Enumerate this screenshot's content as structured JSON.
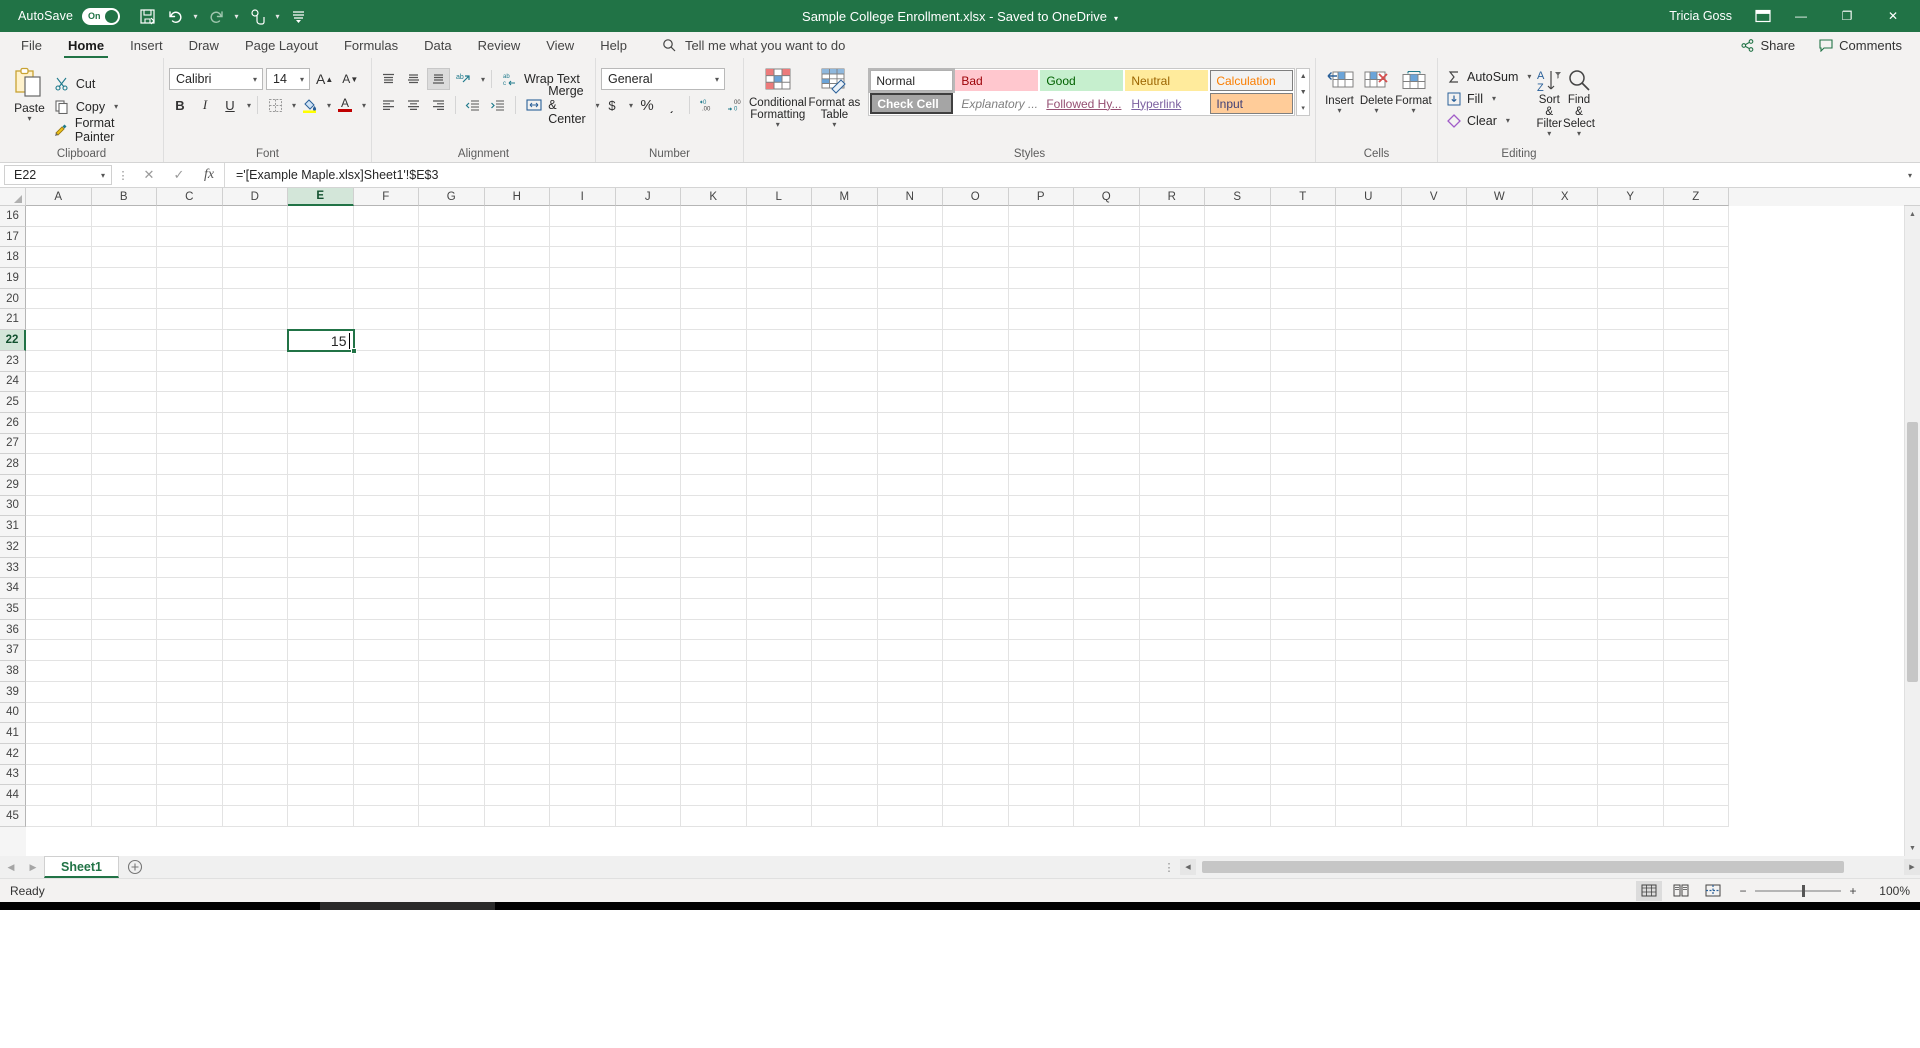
{
  "titlebar": {
    "autosave_label": "AutoSave",
    "autosave_state": "On",
    "document_title": "Sample College Enrollment.xlsx  -  Saved to OneDrive",
    "user_name": "Tricia Goss",
    "qat": [
      {
        "name": "save-icon",
        "glyph": "ὋE"
      },
      {
        "name": "undo-icon",
        "glyph": "↶"
      },
      {
        "name": "redo-icon",
        "glyph": "↷"
      },
      {
        "name": "touch-mode-icon",
        "glyph": "☝"
      },
      {
        "name": "customize-qat-icon",
        "glyph": "≡"
      }
    ],
    "window_buttons": {
      "minimize": "—",
      "restore": "❐",
      "close": "✕"
    },
    "ribbon_display_icon": "ribbon-display-options-icon",
    "accent_color": "#217346"
  },
  "ribbon": {
    "tabs": [
      {
        "label": "File",
        "active": false
      },
      {
        "label": "Home",
        "active": true
      },
      {
        "label": "Insert",
        "active": false
      },
      {
        "label": "Draw",
        "active": false
      },
      {
        "label": "Page Layout",
        "active": false
      },
      {
        "label": "Formulas",
        "active": false
      },
      {
        "label": "Data",
        "active": false
      },
      {
        "label": "Review",
        "active": false
      },
      {
        "label": "View",
        "active": false
      },
      {
        "label": "Help",
        "active": false
      }
    ],
    "tell_me": "Tell me what you want to do",
    "share_label": "Share",
    "comments_label": "Comments",
    "groups": {
      "clipboard": {
        "label": "Clipboard",
        "paste_label": "Paste",
        "cut_label": "Cut",
        "copy_label": "Copy",
        "format_painter_label": "Format Painter"
      },
      "font": {
        "label": "Font",
        "font_name": "Calibri",
        "font_size": "14",
        "grow_font": "A",
        "shrink_font": "A",
        "bold": "B",
        "italic": "I",
        "underline": "U",
        "borders_icon": "borders-icon",
        "fill_color_icon": "fill-color-icon",
        "font_color_icon": "font-color-icon"
      },
      "alignment": {
        "label": "Alignment",
        "wrap_text_label": "Wrap Text",
        "merge_center_label": "Merge & Center",
        "align_top": "align-top-icon",
        "align_middle": "align-middle-icon",
        "align_bottom": "align-bottom-icon",
        "orientation": "orientation-icon",
        "align_left": "align-left-icon",
        "align_center": "align-center-icon",
        "align_right": "align-right-icon",
        "decrease_indent": "decrease-indent-icon",
        "increase_indent": "increase-indent-icon"
      },
      "number": {
        "label": "Number",
        "format": "General",
        "currency": "$",
        "percent": "%",
        "comma": "͵",
        "increase_decimal": "increase-decimal-icon",
        "decrease_decimal": "decrease-decimal-icon"
      },
      "styles": {
        "label": "Styles",
        "conditional_formatting_label": "Conditional Formatting",
        "format_as_table_label": "Format as Table",
        "gallery": [
          {
            "label": "Normal",
            "bg": "#ffffff",
            "fg": "#262626",
            "border": "#b0b0b0",
            "selected": true
          },
          {
            "label": "Bad",
            "bg": "#ffc7ce",
            "fg": "#9c0006",
            "border": "transparent",
            "selected": false
          },
          {
            "label": "Good",
            "bg": "#c6efce",
            "fg": "#006100",
            "border": "transparent",
            "selected": false
          },
          {
            "label": "Neutral",
            "bg": "#ffeb9c",
            "fg": "#9c6500",
            "border": "transparent",
            "selected": false
          },
          {
            "label": "Calculation",
            "bg": "#f2f2f2",
            "fg": "#fa7d00",
            "border": "#7f7f7f",
            "selected": false
          },
          {
            "label": "Check Cell",
            "bg": "#a5a5a5",
            "fg": "#ffffff",
            "border": "#3f3f3f",
            "selected": false
          },
          {
            "label": "Explanatory ...",
            "bg": "#ffffff",
            "fg": "#7f7f7f",
            "border": "transparent",
            "selected": false
          },
          {
            "label": "Followed Hy...",
            "bg": "#ffffff",
            "fg": "#954f72",
            "border": "transparent",
            "selected": false
          },
          {
            "label": "Hyperlink",
            "bg": "#ffffff",
            "fg": "#7c60a0",
            "border": "transparent",
            "selected": false
          },
          {
            "label": "Input",
            "bg": "#ffcc99",
            "fg": "#3f3f76",
            "border": "#7f7f7f",
            "selected": false
          }
        ]
      },
      "cells": {
        "label": "Cells",
        "insert_label": "Insert",
        "delete_label": "Delete",
        "format_label": "Format"
      },
      "editing": {
        "label": "Editing",
        "autosum_label": "AutoSum",
        "fill_label": "Fill",
        "clear_label": "Clear",
        "sort_filter_label": "Sort & Filter",
        "find_select_label": "Find & Select"
      }
    }
  },
  "formula_bar": {
    "name_box": "E22",
    "cancel_icon": "cancel-icon",
    "enter_icon": "confirm-icon",
    "function_icon": "insert-function-icon",
    "formula": "='[Example Maple.xlsx]Sheet1'!$E$3"
  },
  "grid": {
    "columns": [
      "A",
      "B",
      "C",
      "D",
      "E",
      "F",
      "G",
      "H",
      "I",
      "J",
      "K",
      "L",
      "M",
      "N",
      "O",
      "P",
      "Q",
      "R",
      "S",
      "T",
      "U",
      "V",
      "W",
      "X",
      "Y",
      "Z"
    ],
    "selected_column": "E",
    "rows": [
      16,
      17,
      18,
      19,
      20,
      21,
      22,
      23,
      24,
      25,
      26,
      27,
      28,
      29,
      30,
      31,
      32,
      33,
      34,
      35,
      36,
      37,
      38,
      39,
      40,
      41,
      42,
      43,
      44,
      45
    ],
    "selected_row": 22,
    "active_cell": {
      "ref": "E22",
      "value": "15",
      "column": "E",
      "row": 22
    },
    "selection_color": "#217346"
  },
  "sheet_tabs": {
    "tabs": [
      {
        "label": "Sheet1",
        "active": true
      }
    ],
    "add_sheet_icon": "add-sheet-icon",
    "prev_icon": "previous-sheet-icon",
    "next_icon": "next-sheet-icon"
  },
  "status_bar": {
    "status": "Ready",
    "view_normal": "normal-view-icon",
    "view_page_layout": "page-layout-view-icon",
    "view_page_break": "page-break-preview-icon",
    "zoom_out": "−",
    "zoom_in": "+",
    "zoom_level": "100%"
  }
}
